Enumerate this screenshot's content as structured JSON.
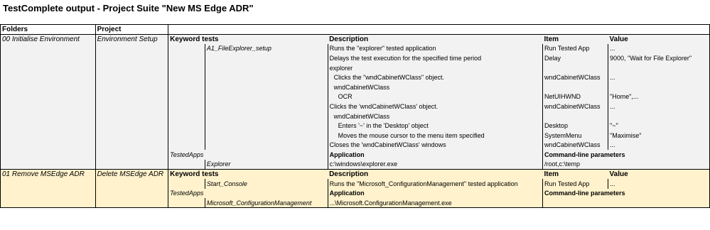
{
  "title": "TestComplete output - Project Suite \"New MS Edge ADR\"",
  "header": {
    "folders": "Folders",
    "project": "Project"
  },
  "section1": {
    "folder": "00 Initialise Environment",
    "project": "Environment Setup",
    "headers": {
      "keyword_tests": "Keyword tests",
      "description": "Description",
      "item": "Item",
      "value": "Value"
    },
    "test_name": "A1_FileExplorer_setup",
    "rows": [
      {
        "description": "Runs the \"explorer\" tested application",
        "item": "Run Tested App",
        "value": "..."
      },
      {
        "description": "Delays the test execution for the specified time period",
        "item": "Delay",
        "value": "9000, \"Wait for File Explorer\""
      },
      {
        "description": "explorer",
        "item": "",
        "value": ""
      },
      {
        "description": "Clicks the \"wndCabinetWClass\" object.",
        "item": "wndCabinetWClass",
        "value": "..."
      },
      {
        "description": "wndCabinetWClass",
        "item": "",
        "value": ""
      },
      {
        "description": "OCR",
        "item": "NetUIHWND",
        "value": "\"Home\",..."
      },
      {
        "description": "Clicks the 'wndCabinetWClass' object.",
        "item": "wndCabinetWClass",
        "value": "..."
      },
      {
        "description": "wndCabinetWClass",
        "item": "",
        "value": ""
      },
      {
        "description": "Enters '~' in the 'Desktop' object",
        "item": "Desktop",
        "value": "\"~\""
      },
      {
        "description": "Moves the mouse cursor to the menu item specified",
        "item": "SystemMenu",
        "value": "\"Maximise\""
      },
      {
        "description": "Closes the 'wndCabinetWClass' windows",
        "item": "wndCabinetWClass",
        "value": "..."
      }
    ],
    "tested_apps_label": "TestedApps",
    "app_header": {
      "application": "Application",
      "cmd": "Command-line parameters"
    },
    "app": {
      "name": "Explorer",
      "path": "c:\\windows\\explorer.exe",
      "params": "/root,c:\\temp"
    }
  },
  "section2": {
    "folder": "01 Remove MSEdge ADR",
    "project": "Delete MSEdge ADR",
    "headers": {
      "keyword_tests": "Keyword tests",
      "description": "Description",
      "item": "Item",
      "value": "Value"
    },
    "test_name": "Start_Console",
    "row": {
      "description": "Runs the \"Microsoft_ConfigurationManagement\" tested application",
      "item": "Run Tested App",
      "value": "..."
    },
    "tested_apps_label": "TestedApps",
    "app_header": {
      "application": "Application",
      "cmd": "Command-line parameters"
    },
    "app": {
      "name": "Microsoft_ConfigurationManagement",
      "path": "...\\Microsoft.ConfigurationManagement.exe"
    }
  }
}
